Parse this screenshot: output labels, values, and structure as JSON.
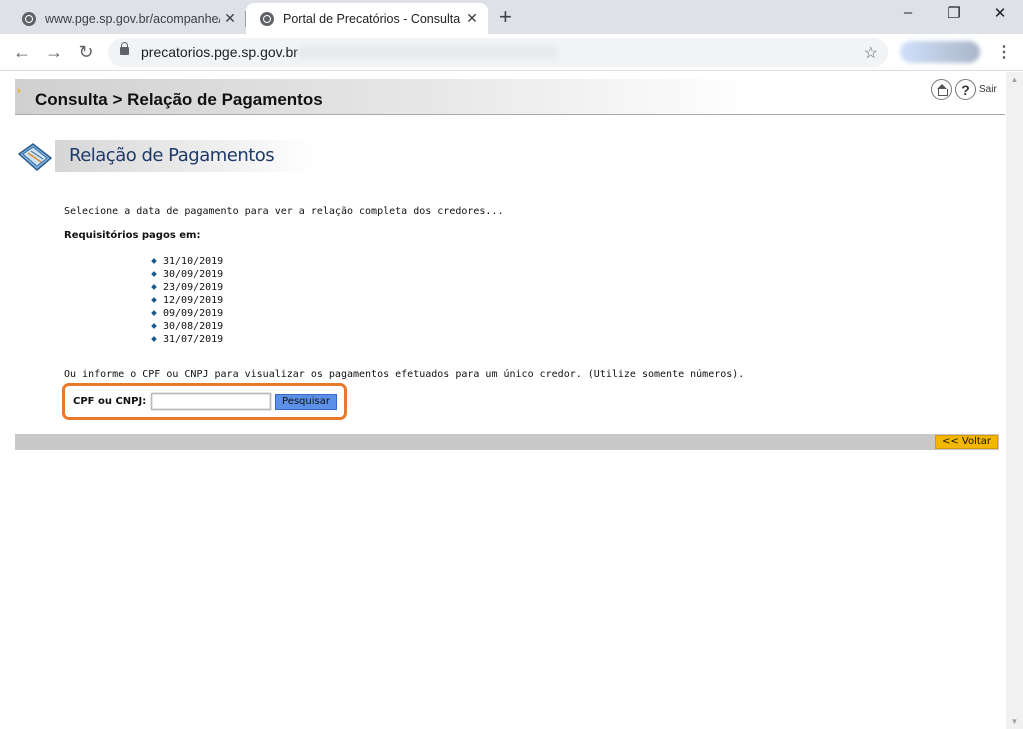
{
  "browser": {
    "tabs": [
      {
        "title": "www.pge.sp.gov.br/acompanhe/p",
        "active": false
      },
      {
        "title": "Portal de Precatórios - Consulta R",
        "active": true
      }
    ],
    "new_tab": "+",
    "window_controls": {
      "minimize": "–",
      "maximize": "❐",
      "close": "✕"
    },
    "url": "precatorios.pge.sp.gov.br"
  },
  "page": {
    "header_title": "Consulta > Relação de Pagamentos",
    "help_label": "?",
    "logout_label": "Sair",
    "section_title": "Relação de Pagamentos",
    "intro_text": "Selecione a data de pagamento para ver a relação completa dos credores...",
    "paid_label": "Requisitórios pagos em:",
    "dates": [
      "31/10/2019",
      "30/09/2019",
      "23/09/2019",
      "12/09/2019",
      "09/09/2019",
      "30/08/2019",
      "31/07/2019"
    ],
    "info_text": "Ou informe o CPF ou CNPJ para visualizar os pagamentos efetuados para um único credor. (Utilize somente números).",
    "search": {
      "label": "CPF ou CNPJ:",
      "value": "",
      "button_label": "Pesquisar"
    },
    "back_label": "<< Voltar"
  },
  "colors": {
    "highlight_border": "#e9792a",
    "search_button": "#5c8fe8",
    "back_button": "#f3b700",
    "section_title": "#1e3a6a"
  }
}
